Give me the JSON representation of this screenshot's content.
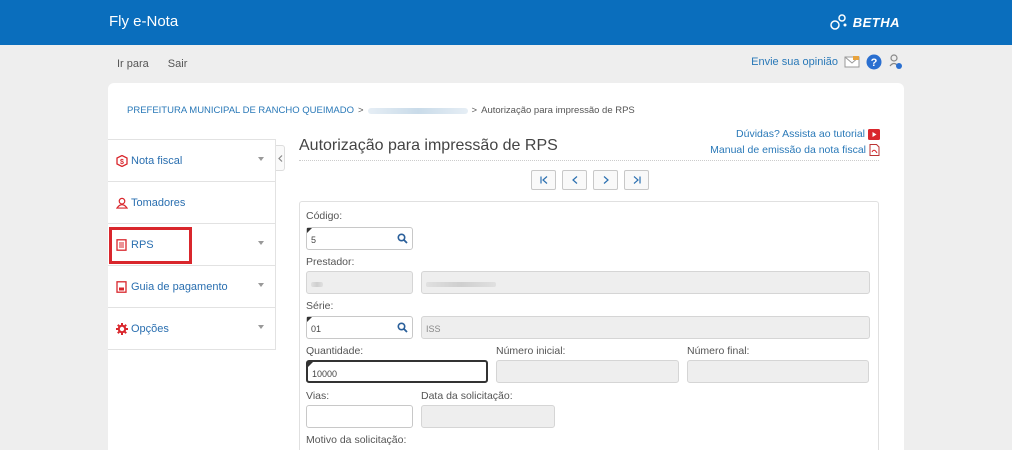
{
  "header": {
    "app_title": "Fly e-Nota",
    "brand": "BETHA"
  },
  "subnav": {
    "goto": "Ir para",
    "exit": "Sair",
    "feedback": "Envie sua opinião"
  },
  "breadcrumb": {
    "first": "PREFEITURA MUNICIPAL DE RANCHO QUEIMADO",
    "sep1": ">",
    "sep2": ">",
    "current": "Autorização para impressão de RPS"
  },
  "sidebar": {
    "items": [
      {
        "label": "Nota fiscal"
      },
      {
        "label": "Tomadores"
      },
      {
        "label": "RPS"
      },
      {
        "label": "Guia de pagamento"
      },
      {
        "label": "Opções"
      }
    ]
  },
  "page": {
    "title": "Autorização para impressão de RPS",
    "help_video": "Dúvidas? Assista ao tutorial",
    "help_manual": "Manual de emissão da nota fiscal"
  },
  "form": {
    "codigo": {
      "label": "Código:",
      "value": "5"
    },
    "prestador": {
      "label": "Prestador:"
    },
    "serie": {
      "label": "Série:",
      "value": "01",
      "description": "ISS"
    },
    "quantidade": {
      "label": "Quantidade:",
      "value": "10000"
    },
    "numero_inicial": {
      "label": "Número inicial:"
    },
    "numero_final": {
      "label": "Número final:"
    },
    "vias": {
      "label": "Vias:"
    },
    "data_solicitacao": {
      "label": "Data da solicitação:"
    },
    "motivo": {
      "label": "Motivo da solicitação:"
    }
  },
  "colors": {
    "topbar": "#0a6ebd",
    "link": "#2a79b8",
    "highlight": "#d9262c"
  }
}
